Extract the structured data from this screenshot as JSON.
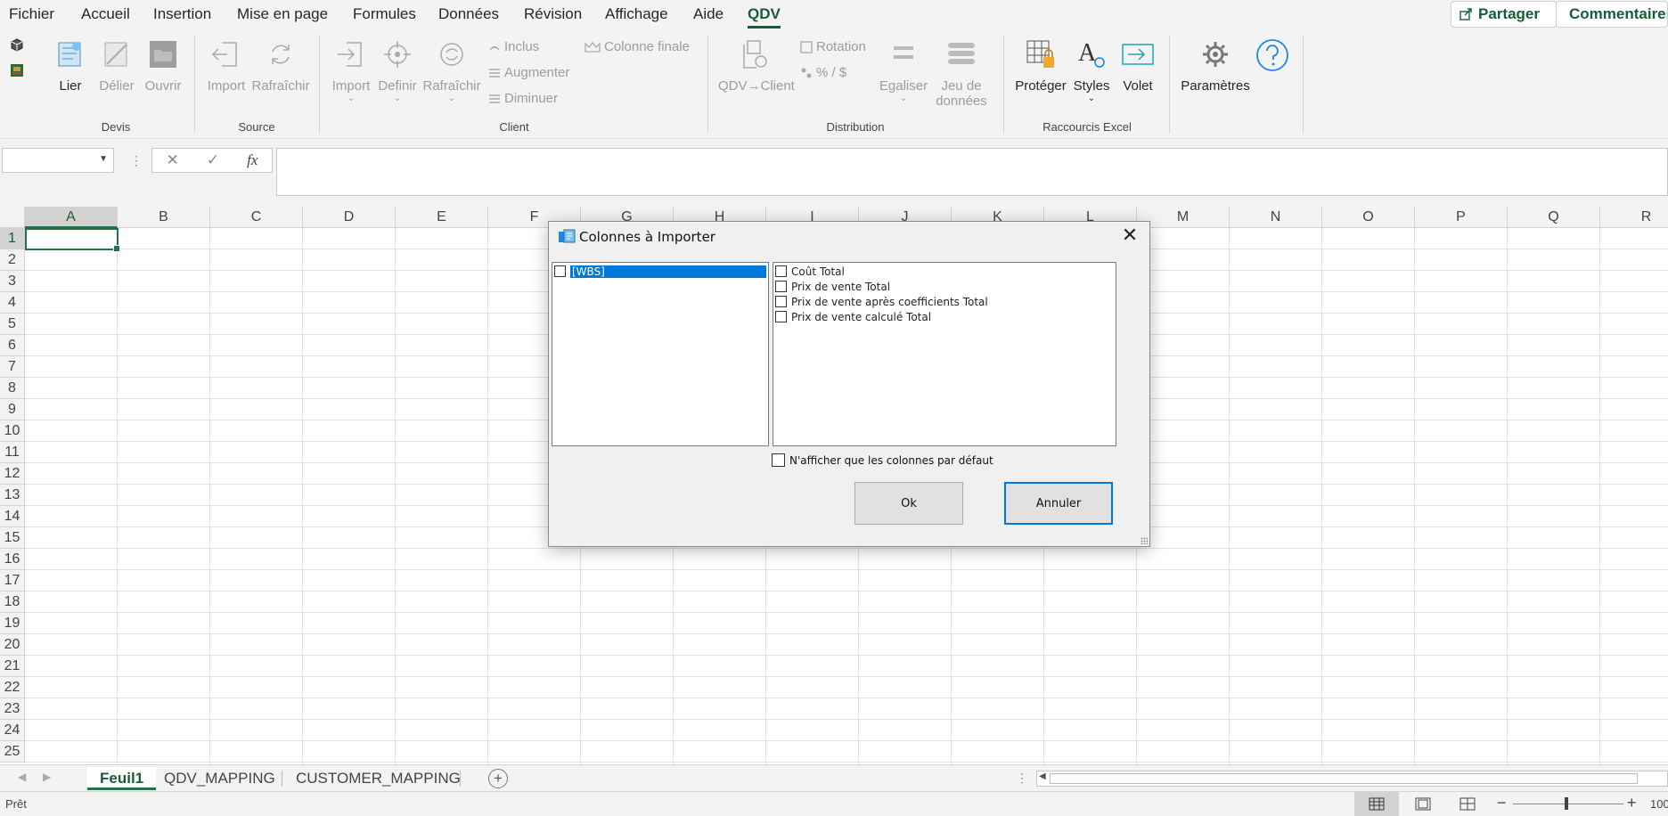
{
  "menu": {
    "tabs": [
      "Fichier",
      "Accueil",
      "Insertion",
      "Mise en page",
      "Formules",
      "Données",
      "Révision",
      "Affichage",
      "Aide",
      "QDV"
    ],
    "share_label": "Partager",
    "comments_label": "Commentaires"
  },
  "ribbon": {
    "devis": {
      "group": "Devis",
      "lier": "Lier",
      "delier": "Délier",
      "ouvrir": "Ouvrir"
    },
    "source": {
      "group": "Source",
      "import": "Import",
      "rafraichir": "Rafraîchir"
    },
    "client": {
      "group": "Client",
      "import": "Import",
      "definir": "Definir",
      "rafraichir": "Rafraîchir",
      "inclus": "Inclus",
      "augmenter": "Augmenter",
      "diminuer": "Diminuer",
      "colonne_finale": "Colonne finale"
    },
    "distribution": {
      "group": "Distribution",
      "qdv_client": "QDV→Client",
      "rotation": "Rotation",
      "percent": "% / $",
      "egaliser": "Egaliser",
      "jeu_line1": "Jeu de",
      "jeu_line2": "données"
    },
    "raccourcis": {
      "group": "Raccourcis Excel",
      "proteger": "Protéger",
      "styles": "Styles",
      "volet": "Volet"
    },
    "parametres": "Paramètres"
  },
  "formula_bar": {
    "fx": "fx",
    "cancel": "✕",
    "enter": "✓"
  },
  "grid": {
    "columns": [
      "A",
      "B",
      "C",
      "D",
      "E",
      "F",
      "G",
      "H",
      "I",
      "J",
      "K",
      "L",
      "M",
      "N",
      "O",
      "P",
      "Q",
      "R"
    ],
    "rows": [
      "1",
      "2",
      "3",
      "4",
      "5",
      "6",
      "7",
      "8",
      "9",
      "10",
      "11",
      "12",
      "13",
      "14",
      "15",
      "16",
      "17",
      "18",
      "19",
      "20",
      "21",
      "22",
      "23",
      "24",
      "25"
    ]
  },
  "sheets": [
    "Feuil1",
    "QDV_MAPPING",
    "CUSTOMER_MAPPING"
  ],
  "status": {
    "ready": "Prêt",
    "zoom": "100"
  },
  "dialog": {
    "title": "Colonnes à Importer",
    "left_items": [
      "[WBS]"
    ],
    "right_items": [
      "Coût Total",
      "Prix de vente Total",
      "Prix de vente après coefficients Total",
      "Prix de vente calculé Total"
    ],
    "default_only_label": "N'afficher que les colonnes par défaut",
    "ok_label": "Ok",
    "cancel_label": "Annuler",
    "close_glyph": "✕"
  },
  "colors": {
    "accent": "#185c37",
    "excel_green": "#217346",
    "selection_blue": "#0078d7"
  }
}
